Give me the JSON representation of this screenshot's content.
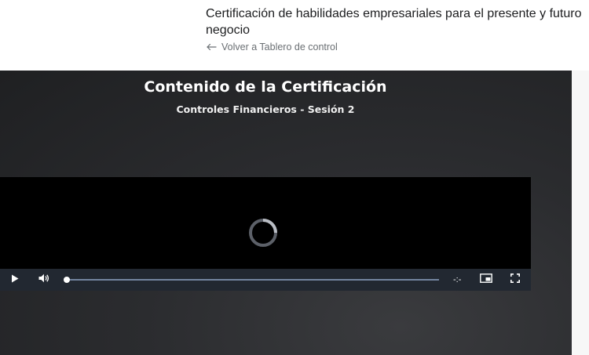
{
  "header": {
    "course_title": "Certificación de habilidades empresariales para el presente y futuro negocio",
    "back_link": "Volver a Tablero de control"
  },
  "stage": {
    "title": "Contenido de la Certificación",
    "subtitle": "Controles Financieros - Sesión 2"
  },
  "player": {
    "state": "loading",
    "progress_fraction": 0,
    "time_display": "-:-",
    "icons": [
      "play-icon",
      "volume-icon",
      "picture-in-picture-icon",
      "fullscreen-icon",
      "loading-spinner-icon"
    ]
  },
  "colors": {
    "stage_background": "#2b2c2f",
    "control_bar": "#2b333f",
    "text_primary": "#1c1d1f",
    "text_secondary": "#6a6f73"
  }
}
